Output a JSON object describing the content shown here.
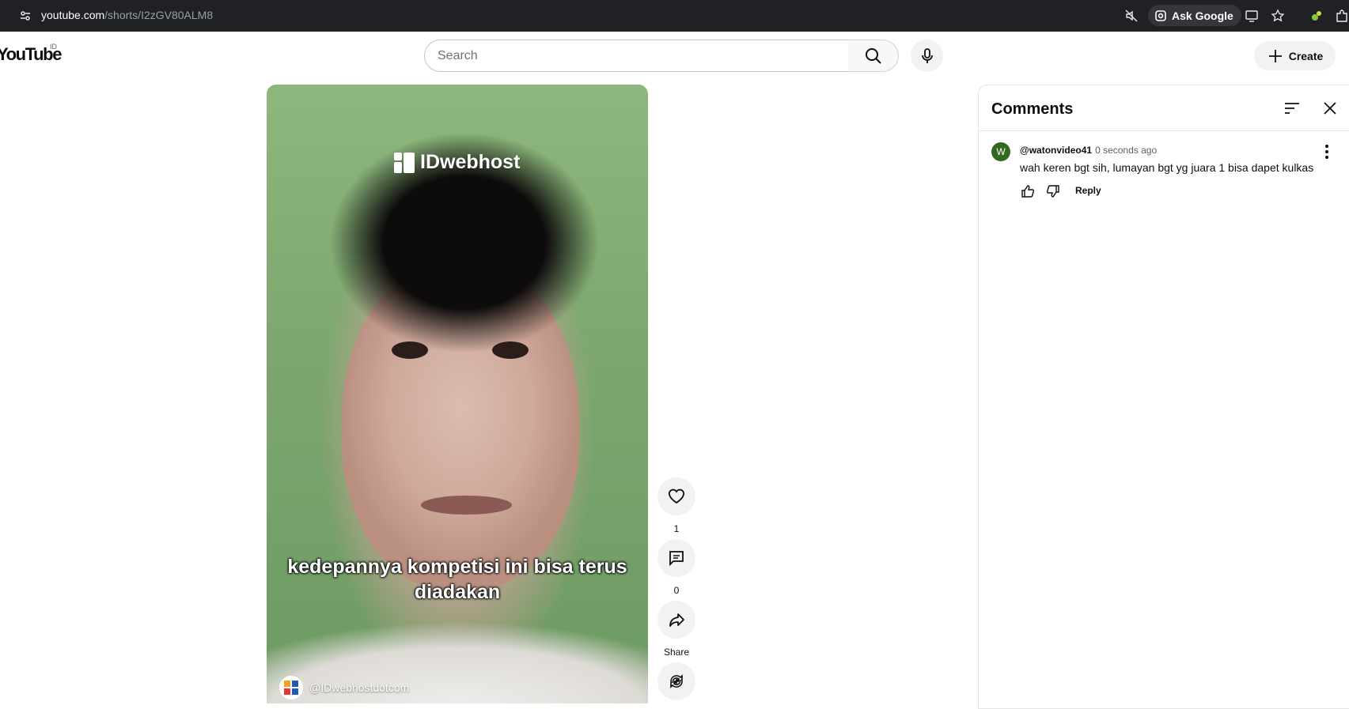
{
  "browser": {
    "url_domain": "youtube.com",
    "url_path": "/shorts/I2zGV80ALM8",
    "ask_google_label": "Ask Google"
  },
  "header": {
    "logo_text": "YouTube",
    "country_code": "ID",
    "search_placeholder": "Search",
    "search_value": "",
    "create_label": "Create"
  },
  "video": {
    "watermark": "IDwebhost",
    "caption": "kedepannya kompetisi ini bisa terus diadakan",
    "channel_handle": "@IDwebhostdotcom"
  },
  "actions": {
    "like_count": "1",
    "comment_count": "0",
    "share_label": "Share"
  },
  "comments": {
    "title": "Comments",
    "items": [
      {
        "avatar_letter": "W",
        "author": "@watonvideo41",
        "time": "0 seconds ago",
        "text": "wah keren bgt sih, lumayan bgt yg juara 1 bisa dapet kulkas",
        "reply_label": "Reply"
      }
    ]
  },
  "colors": {
    "chrome_bar": "#202124",
    "comment_avatar": "#33691e",
    "button_bg": "#f2f2f2"
  }
}
